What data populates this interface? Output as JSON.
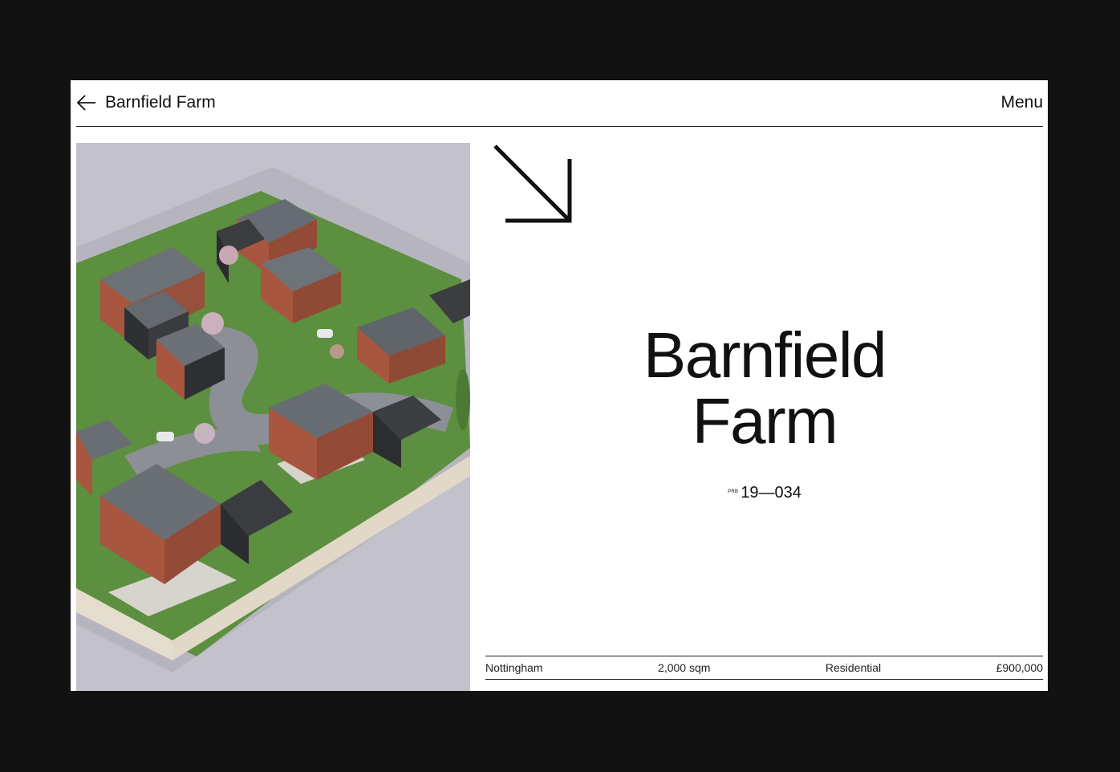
{
  "header": {
    "back_icon": "arrow-left-icon",
    "project_title": "Barnfield Farm",
    "menu_label": "Menu"
  },
  "hero": {
    "image_alt": "Aerial 3D render of the Barnfield Farm housing development",
    "arrow_icon": "arrow-down-right-icon",
    "title_line1": "Barnfield",
    "title_line2": "Farm",
    "reference_prefix": "PRB",
    "reference_number": "19—034"
  },
  "facts": {
    "location": "Nottingham",
    "area": "2,000 sqm",
    "type": "Residential",
    "value": "£900,000"
  },
  "colors": {
    "page_background": "#121212",
    "panel_background": "#ffffff",
    "text": "#111111",
    "render_sky": "#c3c2cc",
    "brick": "#a8563f",
    "roof": "#6f737a",
    "lawn": "#4f8a3a"
  }
}
